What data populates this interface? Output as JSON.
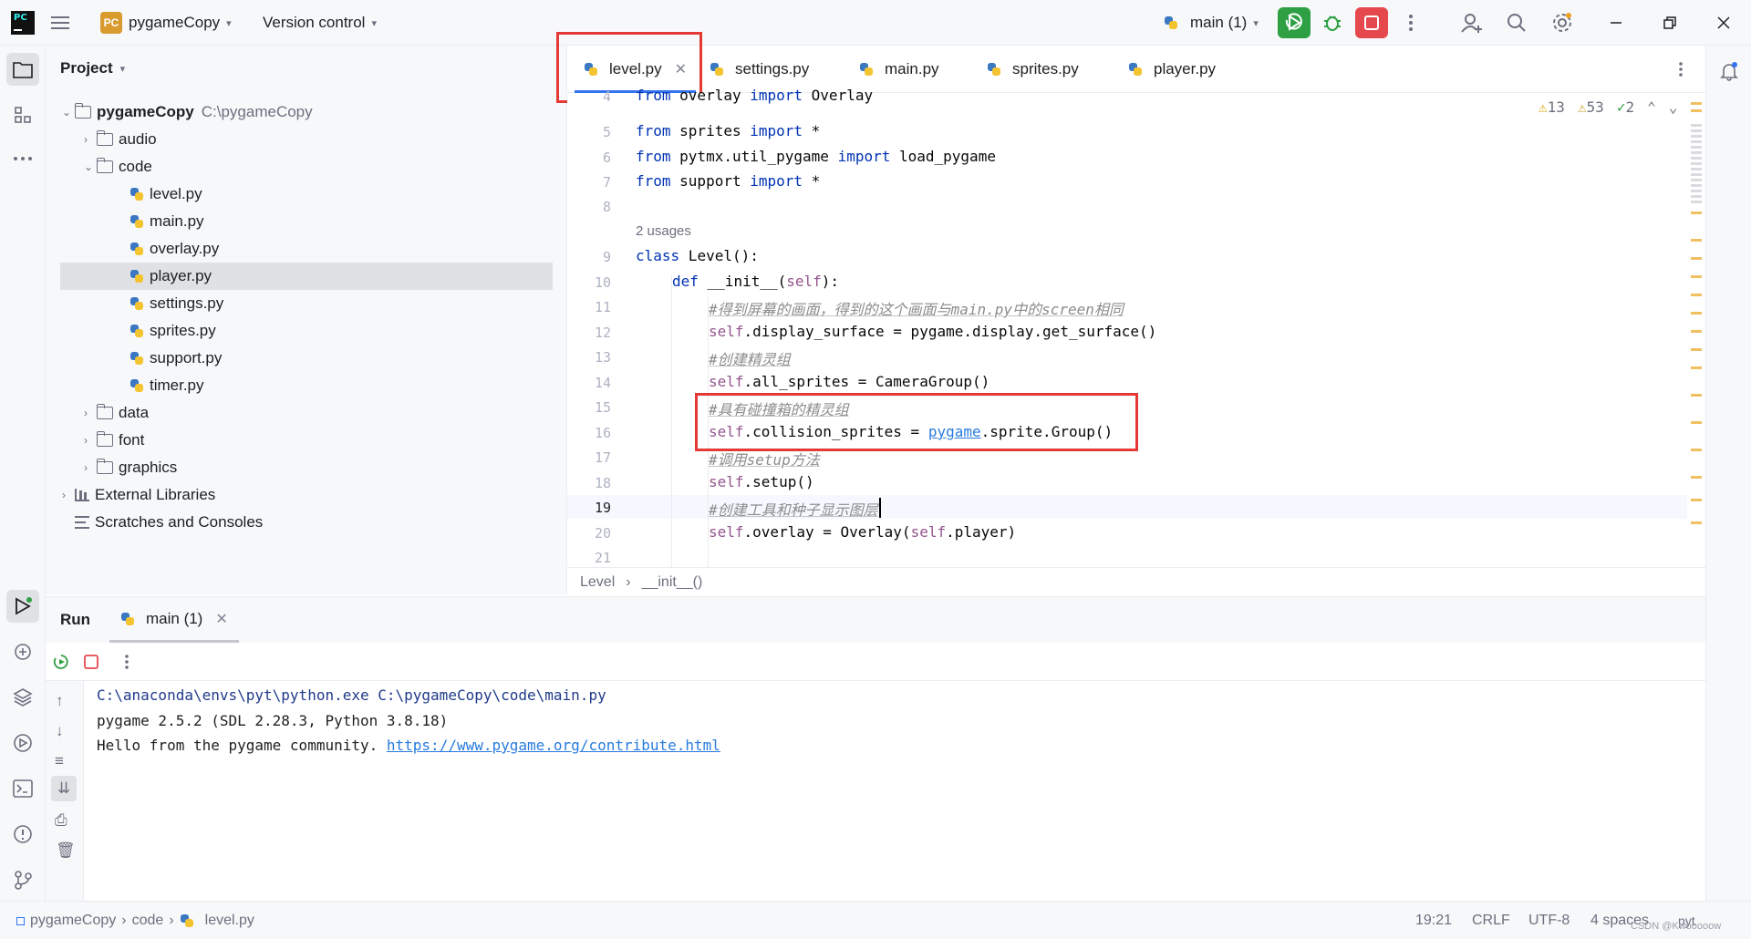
{
  "titlebar": {
    "project_badge": "PC",
    "project_name": "pygameCopy",
    "version_control": "Version control",
    "run_config": "main (1)"
  },
  "project_panel": {
    "title": "Project",
    "root_name": "pygameCopy",
    "root_path": "C:\\pygameCopy",
    "items": [
      {
        "label": "audio"
      },
      {
        "label": "code"
      },
      {
        "label": "level.py"
      },
      {
        "label": "main.py"
      },
      {
        "label": "overlay.py"
      },
      {
        "label": "player.py"
      },
      {
        "label": "settings.py"
      },
      {
        "label": "sprites.py"
      },
      {
        "label": "support.py"
      },
      {
        "label": "timer.py"
      },
      {
        "label": "data"
      },
      {
        "label": "font"
      },
      {
        "label": "graphics"
      },
      {
        "label": "External Libraries"
      },
      {
        "label": "Scratches and Consoles"
      }
    ]
  },
  "tabs": [
    {
      "label": "level.py"
    },
    {
      "label": "settings.py"
    },
    {
      "label": "main.py"
    },
    {
      "label": "sprites.py"
    },
    {
      "label": "player.py"
    }
  ],
  "inspections": {
    "warnings": "13",
    "weak_warnings": "53",
    "typos": "2"
  },
  "editor": {
    "usages_hint": "2 usages",
    "line_numbers": [
      "4",
      "5",
      "6",
      "7",
      "8",
      "9",
      "10",
      "11",
      "12",
      "13",
      "14",
      "15",
      "16",
      "17",
      "18",
      "19",
      "20",
      "21"
    ],
    "code": {
      "l4a": "from",
      "l4b": " overlay ",
      "l4c": "import",
      "l4d": " Overlay",
      "l5a": "from",
      "l5b": " sprites ",
      "l5c": "import",
      "l5d": " *",
      "l6a": "from",
      "l6b": " pytmx.util_pygame ",
      "l6c": "import",
      "l6d": " load_pygame",
      "l7a": "from",
      "l7b": " support ",
      "l7c": "import",
      "l7d": " *",
      "l9a": "class",
      "l9b": " Level():",
      "l10a": "def",
      "l10b": " __init__(",
      "l10c": "self",
      "l10d": "):",
      "l11": "#得到屏幕的画面，得到的这个画面与main.py中的screen相同",
      "l12a": "self",
      "l12b": ".display_surface = pygame.display.get_surface()",
      "l13": "#创建精灵组",
      "l14a": "self",
      "l14b": ".all_sprites = CameraGroup()",
      "l15": "#具有碰撞箱的精灵组",
      "l16a": "self",
      "l16b": ".collision_sprites = ",
      "l16c": "pygame",
      "l16d": ".sprite.Group()",
      "l17": "#调用setup方法",
      "l18a": "self",
      "l18b": ".setup()",
      "l19": "#创建工具和种子显示图层",
      "l20a": "self",
      "l20b": ".overlay = Overlay(",
      "l20c": "self",
      "l20d": ".player)"
    }
  },
  "breadcrumbs": {
    "class": "Level",
    "method": "__init__()"
  },
  "run": {
    "title": "Run",
    "tab": "main (1)",
    "output": [
      "C:\\anaconda\\envs\\pyt\\python.exe C:\\pygameCopy\\code\\main.py",
      "pygame 2.5.2 (SDL 2.28.3, Python 3.8.18)",
      "Hello from the pygame community. "
    ],
    "link": "https://www.pygame.org/contribute.html"
  },
  "statusbar": {
    "path": [
      "pygameCopy",
      "code",
      "level.py"
    ],
    "position": "19:21",
    "line_sep": "CRLF",
    "encoding": "UTF-8",
    "indent": "4 spaces",
    "interpreter": "pyt",
    "watermark": "CSDN @Kwooooow"
  },
  "colors": {
    "accent": "#3574f0",
    "highlight_box": "#e53935",
    "run_green": "#2ea043",
    "stop_red": "#e5484d"
  }
}
